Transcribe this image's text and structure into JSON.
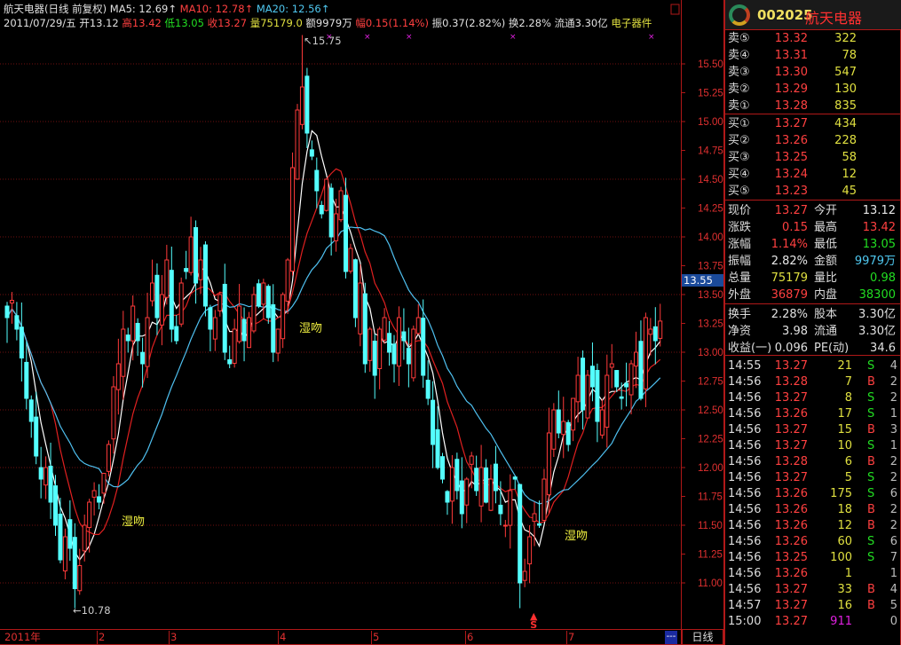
{
  "header": {
    "name_mode": "航天电器(日线 前复权)",
    "ma5": "MA5: 12.69↑",
    "ma10": "MA10: 12.78↑",
    "ma20": "MA20: 12.56↑",
    "date": "2011/07/29/五",
    "open_l": "开",
    "open": "13.12",
    "high_l": "高",
    "high": "13.42",
    "low_l": "低",
    "low": "13.05",
    "close_l": "收",
    "close": "13.27",
    "vol_l": "量",
    "vol": "75179.0",
    "amt": "额9979万",
    "chg_l": "幅",
    "chg": "0.15(1.14%)",
    "amp": "振0.37(2.82%)",
    "turn": "换2.28%",
    "float": "流通3.30亿",
    "sector": "电子器件"
  },
  "colors": {
    "up": "#ff3a3a",
    "down": "#54ffff",
    "ma5": "#ffffff",
    "ma10": "#e02020",
    "ma20": "#4fc0f0",
    "grid": "#701010",
    "axis": "#b01818"
  },
  "chart_data": {
    "type": "candlestick",
    "price_axis": [
      "15.50",
      "15.25",
      "15.00",
      "14.75",
      "14.50",
      "14.25",
      "14.00",
      "13.75",
      "13.50",
      "13.25",
      "13.00",
      "12.75",
      "12.50",
      "12.25",
      "12.00",
      "11.75",
      "11.50",
      "11.25",
      "11.00"
    ],
    "ylim": [
      10.7,
      15.85
    ],
    "cursor_price": "13.55",
    "x_labels": [
      "2011年",
      "2",
      "3",
      "4",
      "5",
      "6",
      "7"
    ],
    "close": [
      13.3,
      13.45,
      13.2,
      12.95,
      12.6,
      12.4,
      12.1,
      11.9,
      12.0,
      11.7,
      11.5,
      11.2,
      11.4,
      11.3,
      10.95,
      11.15,
      11.5,
      11.7,
      11.8,
      11.7,
      11.95,
      12.2,
      12.7,
      12.9,
      13.2,
      13.1,
      13.4,
      13.1,
      12.9,
      13.3,
      13.6,
      13.3,
      13.5,
      13.8,
      13.2,
      13.1,
      13.6,
      13.7,
      14.0,
      13.6,
      13.8,
      13.4,
      13.2,
      13.3,
      13.5,
      13.0,
      12.9,
      13.2,
      13.4,
      13.1,
      13.3,
      13.5,
      13.4,
      13.6,
      13.3,
      13.0,
      13.2,
      13.5,
      13.8,
      14.6,
      15.1,
      15.3,
      14.9,
      14.7,
      14.4,
      14.2,
      14.5,
      14.0,
      14.2,
      14.4,
      13.7,
      13.9,
      13.3,
      13.6,
      12.9,
      13.2,
      12.8,
      13.2,
      13.3,
      13.0,
      12.9,
      13.3,
      13.1,
      12.9,
      13.2,
      13.3,
      12.8,
      12.6,
      12.2,
      12.0,
      11.9,
      11.7,
      12.0,
      11.8,
      11.6,
      11.9,
      12.1,
      11.8,
      12.0,
      11.7,
      11.9,
      11.8,
      11.6,
      11.5,
      11.8,
      11.9,
      11.0,
      11.1,
      11.4,
      11.6,
      11.5,
      11.9,
      12.3,
      12.5,
      12.3,
      12.4,
      12.2,
      12.6,
      12.8,
      12.5,
      12.8,
      12.7,
      12.4,
      12.5,
      12.8,
      12.9,
      12.7,
      12.6,
      12.7,
      12.9,
      13.0,
      12.6,
      13.3,
      13.2,
      13.1,
      13.27
    ],
    "last_bar": {
      "open": 13.12,
      "high": 13.42,
      "low": 13.05,
      "close": 13.27
    },
    "max_label": "15.75",
    "min_label": "10.78",
    "max_value": 15.75,
    "min_value": 10.78,
    "annotations": [
      "湿吻",
      "湿吻",
      "湿吻"
    ],
    "signal": "S",
    "series": [
      {
        "name": "MA5",
        "period": 5
      },
      {
        "name": "MA10",
        "period": 10
      },
      {
        "name": "MA20",
        "period": 20
      }
    ]
  },
  "bottom": {
    "period_btn": "---",
    "period": "日线"
  },
  "quote": {
    "code": "002025",
    "name": "航天电器",
    "sell": [
      {
        "l": "卖⑤",
        "p": "13.32",
        "v": "322"
      },
      {
        "l": "卖④",
        "p": "13.31",
        "v": "78"
      },
      {
        "l": "卖③",
        "p": "13.30",
        "v": "547"
      },
      {
        "l": "卖②",
        "p": "13.29",
        "v": "130"
      },
      {
        "l": "卖①",
        "p": "13.28",
        "v": "835"
      }
    ],
    "buy": [
      {
        "l": "买①",
        "p": "13.27",
        "v": "434"
      },
      {
        "l": "买②",
        "p": "13.26",
        "v": "228"
      },
      {
        "l": "买③",
        "p": "13.25",
        "v": "58"
      },
      {
        "l": "买④",
        "p": "13.24",
        "v": "12"
      },
      {
        "l": "买⑤",
        "p": "13.23",
        "v": "45"
      }
    ],
    "stats": [
      {
        "l1": "现价",
        "v1": "13.27",
        "c1": "r",
        "l2": "今开",
        "v2": "13.12",
        "c2": "w"
      },
      {
        "l1": "涨跌",
        "v1": "0.15",
        "c1": "r",
        "l2": "最高",
        "v2": "13.42",
        "c2": "r"
      },
      {
        "l1": "涨幅",
        "v1": "1.14%",
        "c1": "r",
        "l2": "最低",
        "v2": "13.05",
        "c2": "g"
      },
      {
        "l1": "振幅",
        "v1": "2.82%",
        "c1": "w",
        "l2": "金额",
        "v2": "9979万",
        "c2": "c"
      },
      {
        "l1": "总量",
        "v1": "75179",
        "c1": "y",
        "l2": "量比",
        "v2": "0.98",
        "c2": "g"
      },
      {
        "l1": "外盘",
        "v1": "36879",
        "c1": "r",
        "l2": "内盘",
        "v2": "38300",
        "c2": "g"
      }
    ],
    "fund": [
      {
        "l1": "换手",
        "v1": "2.28%",
        "l2": "股本",
        "v2": "3.30亿"
      },
      {
        "l1": "净资",
        "v1": "3.98",
        "l2": "流通",
        "v2": "3.30亿"
      },
      {
        "l1": "收益(一)",
        "v1": "0.096",
        "l2": "PE(动)",
        "v2": "34.6"
      }
    ],
    "trades": [
      {
        "t": "14:55",
        "p": "13.27",
        "v": "21",
        "bs": "S",
        "n": "4"
      },
      {
        "t": "14:56",
        "p": "13.28",
        "v": "7",
        "bs": "B",
        "n": "2"
      },
      {
        "t": "14:56",
        "p": "13.27",
        "v": "8",
        "bs": "S",
        "n": "2"
      },
      {
        "t": "14:56",
        "p": "13.26",
        "v": "17",
        "bs": "S",
        "n": "1"
      },
      {
        "t": "14:56",
        "p": "13.27",
        "v": "15",
        "bs": "B",
        "n": "3"
      },
      {
        "t": "14:56",
        "p": "13.27",
        "v": "10",
        "bs": "S",
        "n": "1"
      },
      {
        "t": "14:56",
        "p": "13.28",
        "v": "6",
        "bs": "B",
        "n": "2"
      },
      {
        "t": "14:56",
        "p": "13.27",
        "v": "5",
        "bs": "S",
        "n": "2"
      },
      {
        "t": "14:56",
        "p": "13.26",
        "v": "175",
        "bs": "S",
        "n": "6"
      },
      {
        "t": "14:56",
        "p": "13.26",
        "v": "18",
        "bs": "B",
        "n": "2"
      },
      {
        "t": "14:56",
        "p": "13.26",
        "v": "12",
        "bs": "B",
        "n": "2"
      },
      {
        "t": "14:56",
        "p": "13.26",
        "v": "60",
        "bs": "S",
        "n": "6"
      },
      {
        "t": "14:56",
        "p": "13.25",
        "v": "100",
        "bs": "S",
        "n": "7"
      },
      {
        "t": "14:56",
        "p": "13.26",
        "v": "1",
        "bs": "",
        "n": "1"
      },
      {
        "t": "14:56",
        "p": "13.27",
        "v": "33",
        "bs": "B",
        "n": "4"
      },
      {
        "t": "14:57",
        "p": "13.27",
        "v": "16",
        "bs": "B",
        "n": "5"
      },
      {
        "t": "15:00",
        "p": "13.27",
        "v": "911",
        "bs": "",
        "n": "0"
      }
    ]
  }
}
